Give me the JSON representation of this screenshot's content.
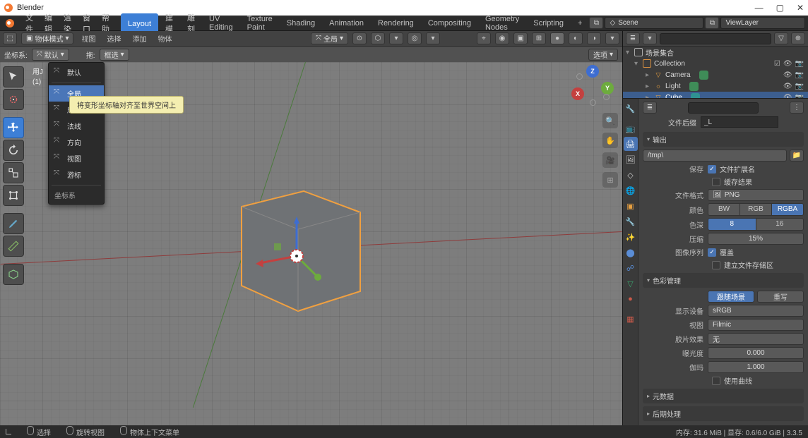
{
  "title": "Blender",
  "menus": {
    "file": "文件",
    "edit": "编辑",
    "render": "渲染",
    "window": "窗口",
    "help": "帮助"
  },
  "tabs": [
    "Layout",
    "建模",
    "雕刻",
    "UV Editing",
    "Texture Paint",
    "Shading",
    "Animation",
    "Rendering",
    "Compositing",
    "Geometry Nodes",
    "Scripting"
  ],
  "active_tab": 0,
  "header_right": {
    "scene_label": "Scene",
    "viewlayer_label": "ViewLayer"
  },
  "view_header": {
    "mode": "物体模式",
    "menus": [
      "视图",
      "选择",
      "添加",
      "物体"
    ],
    "orientation": "全局",
    "snap": "选项"
  },
  "subheader": {
    "coord_label": "坐标系:",
    "coord_value": "默认",
    "drag_label": "拖:",
    "drag_value": "框选"
  },
  "info": {
    "l1": "用J",
    "l2": "(1)"
  },
  "coord_dropdown": {
    "items": [
      "默认",
      "全局",
      "局部",
      "法线",
      "方向",
      "视图",
      "游标"
    ],
    "highlighted": 1,
    "footer": "坐标系"
  },
  "tooltip": "将变形坐标轴对齐至世界空间上",
  "gizmo": {
    "x": "X",
    "y": "Y",
    "z": "Z"
  },
  "outliner": {
    "root": "场景集合",
    "collection": "Collection",
    "items": [
      {
        "name": "Camera",
        "icon": "camera"
      },
      {
        "name": "Light",
        "icon": "light"
      },
      {
        "name": "Cube",
        "icon": "mesh",
        "selected": true
      }
    ]
  },
  "props": {
    "suffix_label": "文件后缀",
    "suffix_value": "_L",
    "panels": {
      "output": "输出",
      "color": "色彩管理",
      "meta": "元数据",
      "post": "后期处理"
    },
    "output": {
      "path": "/tmp\\",
      "save_label": "保存",
      "ext_label": "文件扩展名",
      "cache_label": "缓存结果",
      "format_label": "文件格式",
      "format_value": "PNG",
      "color_label": "颜色",
      "color_opts": [
        "BW",
        "RGB",
        "RGBA"
      ],
      "color_sel": 2,
      "depth_label": "色深",
      "depth_opts": [
        "8",
        "16"
      ],
      "depth_sel": 0,
      "compress_label": "压缩",
      "compress_value": "15%",
      "seq_label": "图像序列",
      "overwrite_label": "覆盖",
      "placeholder_label": "建立文件存储区"
    },
    "colormgmt": {
      "follow_scene": "跟随场景",
      "overwrite": "重写",
      "device_label": "显示设备",
      "device_value": "sRGB",
      "view_label": "视图",
      "view_value": "Filmic",
      "look_label": "胶片效果",
      "look_value": "无",
      "exposure_label": "曝光度",
      "exposure_value": "0.000",
      "gamma_label": "伽玛",
      "gamma_value": "1.000",
      "curve_label": "使用曲线"
    }
  },
  "status": {
    "items": [
      "选择",
      "旋转视图",
      "物体上下文菜单"
    ],
    "memory": "内存: 31.6 MiB | 显存: 0.6/6.0 GiB | 3.3.5"
  }
}
